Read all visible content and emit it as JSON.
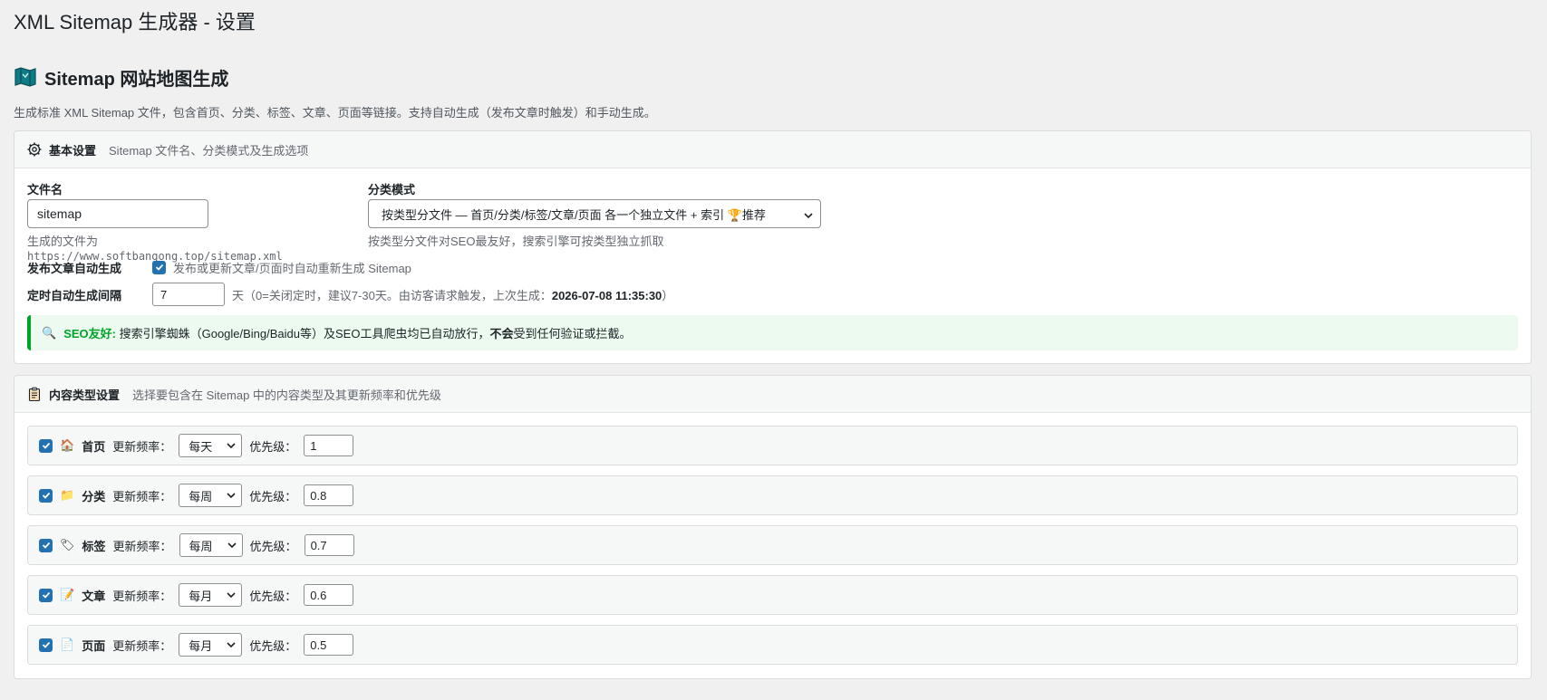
{
  "window_title": "XML Sitemap 生成器 - 设置",
  "page": {
    "title": "Sitemap 网站地图生成",
    "description": "生成标准 XML Sitemap 文件，包含首页、分类、标签、文章、页面等链接。支持自动生成（发布文章时触发）和手动生成。"
  },
  "basic": {
    "title": "基本设置",
    "subtitle": "Sitemap 文件名、分类模式及生成选项",
    "filename_label": "文件名",
    "filename_value": "sitemap",
    "filename_hint_prefix": "生成的文件为",
    "filename_hint_url": "https://www.softbangong.top/sitemap.xml",
    "mode_label": "分类模式",
    "mode_value": "按类型分文件 — 首页/分类/标签/文章/页面 各一个独立文件 + 索引 🏆推荐",
    "mode_hint": "按类型分文件对SEO最友好，搜索引擎可按类型独立抓取",
    "auto_label": "发布文章自动生成",
    "auto_text": "发布或更新文章/页面时自动重新生成 Sitemap",
    "auto_checked": true,
    "interval_label": "定时自动生成间隔",
    "interval_value": "7",
    "interval_text_prefix": "天（0=关闭定时，建议7-30天。由访客请求触发，上次生成：",
    "interval_last": "2026-07-08 11:35:30",
    "interval_text_suffix": "）",
    "notice_emoji": "🔍",
    "notice_strong": "SEO友好:",
    "notice_text_1": " 搜索引擎蜘蛛（Google/Bing/Baidu等）及SEO工具爬虫均已自动放行，",
    "notice_bold": "不会",
    "notice_text_2": "受到任何验证或拦截。"
  },
  "content": {
    "title": "内容类型设置",
    "subtitle": "选择要包含在 Sitemap 中的内容类型及其更新频率和优先级",
    "freq_label": "更新频率：",
    "priority_label": "优先级：",
    "items": [
      {
        "name": "首页",
        "icon": "home-icon",
        "emoji": "🏠",
        "freq": "每天",
        "priority": "1",
        "checked": true
      },
      {
        "name": "分类",
        "icon": "folder-icon",
        "emoji": "📁",
        "freq": "每周",
        "priority": "0.8",
        "checked": true
      },
      {
        "name": "标签",
        "icon": "tag-icon",
        "emoji": "🏷",
        "freq": "每周",
        "priority": "0.7",
        "checked": true
      },
      {
        "name": "文章",
        "icon": "memo-icon",
        "emoji": "📝",
        "freq": "每月",
        "priority": "0.6",
        "checked": true
      },
      {
        "name": "页面",
        "icon": "page-icon",
        "emoji": "📄",
        "freq": "每月",
        "priority": "0.5",
        "checked": true
      }
    ]
  },
  "colors": {
    "accent": "#2271b1",
    "success": "#00a32a",
    "notice_bg": "#edfaef"
  }
}
